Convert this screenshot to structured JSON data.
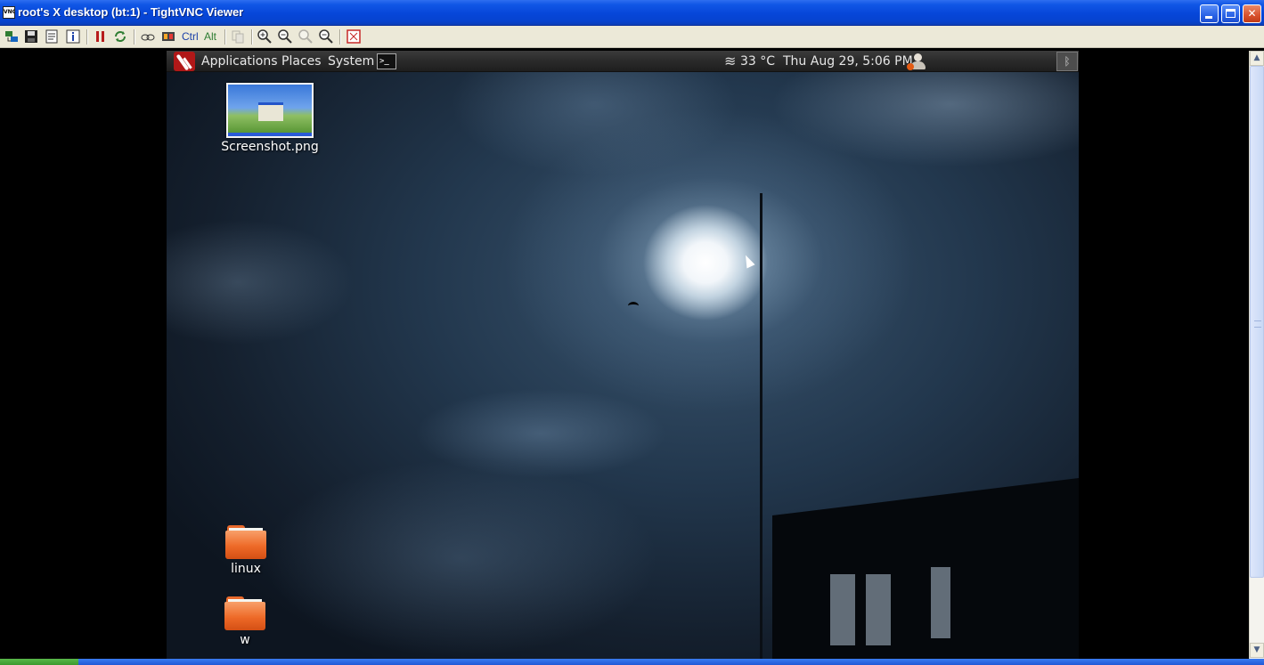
{
  "window": {
    "title": "root's X desktop (bt:1) - TightVNC Viewer",
    "app_icon_label": "VNC",
    "controls": {
      "minimize_icon": "minimize-icon",
      "maximize_icon": "maximize-icon",
      "close_glyph": "✕"
    }
  },
  "toolbar": {
    "ctrl_label": "Ctrl",
    "alt_label": "Alt",
    "icons": [
      "new-connection-icon",
      "save-icon",
      "options-icon",
      "info-icon",
      "pause-icon",
      "refresh-icon",
      "ctrl-alt-del-icon",
      "transfer-icon",
      "copy-icon",
      "zoom-in-icon",
      "zoom-out-icon",
      "zoom-100-icon",
      "zoom-fit-icon",
      "fullscreen-icon"
    ]
  },
  "remote_panel": {
    "menus": [
      "Applications",
      "Places",
      "System"
    ],
    "temperature": "33 °C",
    "datetime": "Thu Aug 29,  5:06 PM",
    "terminal_glyph": ">_",
    "bluetooth_glyph": "ᛒ"
  },
  "desktop_icons": [
    {
      "label": "Screenshot.png",
      "kind": "image-thumbnail"
    },
    {
      "label": "linux",
      "kind": "folder"
    },
    {
      "label": "w",
      "kind": "folder"
    }
  ],
  "colors": {
    "xp_title_blue": "#0646d9",
    "toolbar_bg": "#ece9d8",
    "panel_bg": "#2a2a2a",
    "folder_orange": "#ee6a28",
    "backtrack_red": "#b01818"
  },
  "scrollbar": {
    "up_glyph": "▲",
    "down_glyph": "▼"
  }
}
